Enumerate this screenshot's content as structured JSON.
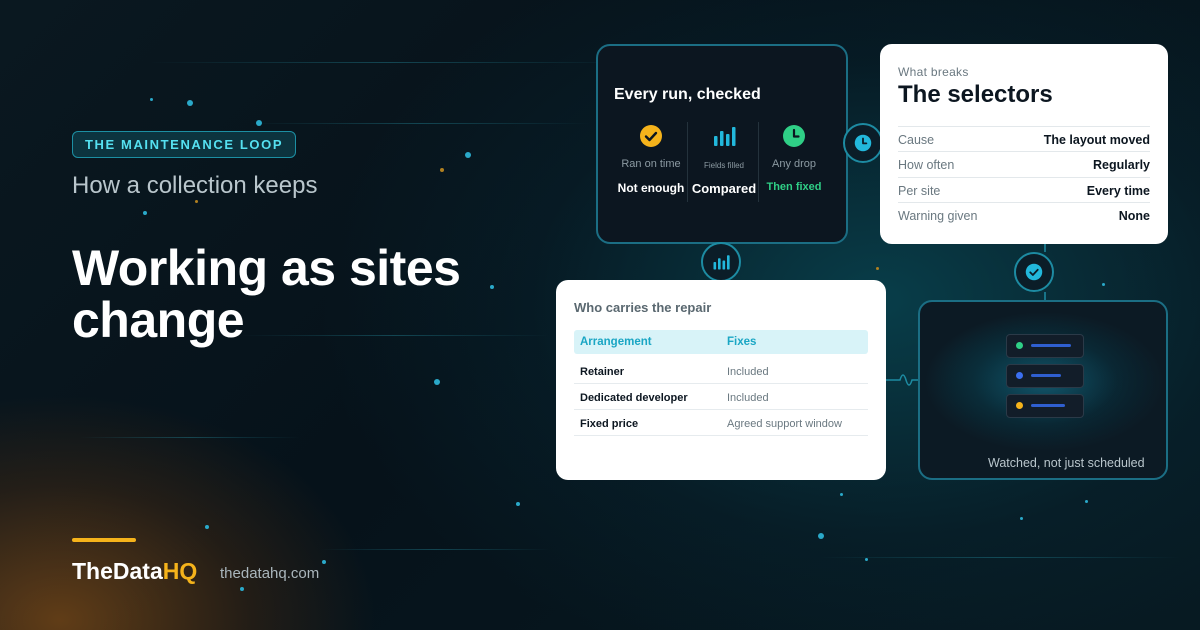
{
  "left": {
    "eyebrow": "THE MAINTENANCE LOOP",
    "subtitle": "How a collection keeps",
    "headline": "Working as sites change"
  },
  "brand": {
    "name_main": "TheData",
    "name_accent": "HQ",
    "url": "thedatahq.com",
    "accent_color": "#f5b31b"
  },
  "runs_card": {
    "title": "Every run, checked",
    "metrics": [
      {
        "icon": "check-circle-icon",
        "label": "Ran on time",
        "value": "Not enough",
        "color": "#f5b31b"
      },
      {
        "icon": "bar-chart-icon",
        "label": "Fields filled",
        "value": "Compared",
        "color": "#22b8dc"
      },
      {
        "icon": "clock-icon",
        "label": "Any drop",
        "value": "Then fixed",
        "color": "#2fcf86"
      }
    ]
  },
  "selectors_card": {
    "kicker": "What breaks",
    "title": "The selectors",
    "rows": [
      {
        "key": "Cause",
        "value": "The layout moved"
      },
      {
        "key": "How often",
        "value": "Regularly"
      },
      {
        "key": "Per site",
        "value": "Every time"
      },
      {
        "key": "Warning given",
        "value": "None"
      }
    ]
  },
  "repair_card": {
    "title": "Who carries the repair",
    "headers": [
      "Arrangement",
      "Fixes"
    ],
    "rows": [
      [
        "Retainer",
        "Included"
      ],
      [
        "Dedicated developer",
        "Included"
      ],
      [
        "Fixed price",
        "Agreed support window"
      ]
    ]
  },
  "watch_card": {
    "caption": "Watched, not just scheduled",
    "servers": [
      {
        "led_color": "#2fcf86"
      },
      {
        "led_color": "#3b6ff0"
      },
      {
        "led_color": "#f5b31b"
      }
    ]
  },
  "nodes": [
    {
      "icon": "clock-icon"
    },
    {
      "icon": "bar-chart-icon"
    },
    {
      "icon": "check-circle-icon"
    }
  ]
}
